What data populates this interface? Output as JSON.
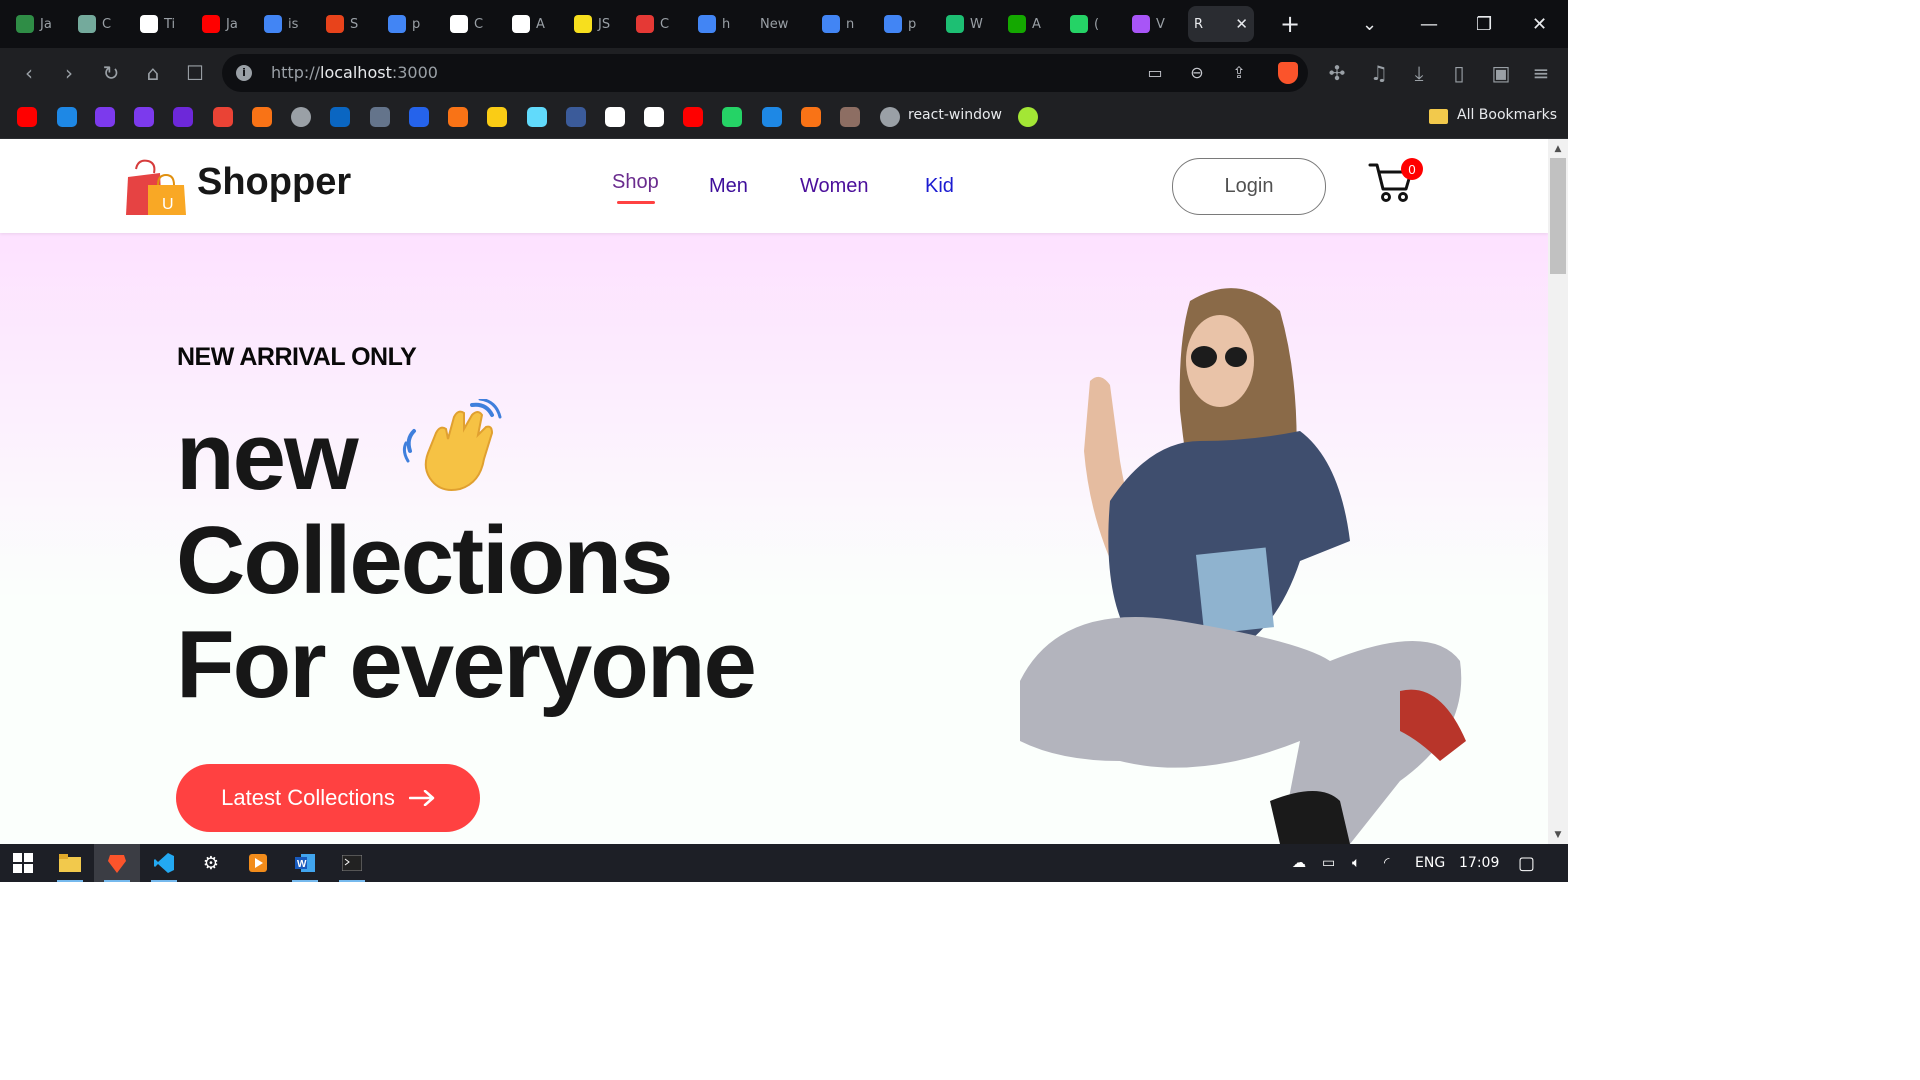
{
  "browser": {
    "tabs": [
      {
        "icon": "geeksforgeeks-icon",
        "label": "Ja",
        "color": "#2f8d46"
      },
      {
        "icon": "chatgpt-icon",
        "label": "C",
        "color": "#74aa9c"
      },
      {
        "icon": "k-icon",
        "label": "Ti",
        "color": "#ffffff"
      },
      {
        "icon": "youtube-icon",
        "label": "Ja",
        "color": "#ff0000"
      },
      {
        "icon": "google-icon",
        "label": "is",
        "color": "#4285f4"
      },
      {
        "icon": "91-icon",
        "label": "S",
        "color": "#e8431b"
      },
      {
        "icon": "google-icon",
        "label": "p",
        "color": "#4285f4"
      },
      {
        "icon": "amazon-icon",
        "label": "C",
        "color": "#ffffff"
      },
      {
        "icon": "amazon-icon",
        "label": "A",
        "color": "#ffffff"
      },
      {
        "icon": "js-icon",
        "label": "JS",
        "color": "#f7df1e"
      },
      {
        "icon": "code-icon",
        "label": "C",
        "color": "#e53935"
      },
      {
        "icon": "google-icon",
        "label": "h",
        "color": "#4285f4"
      },
      {
        "icon": "",
        "label": "New",
        "color": ""
      },
      {
        "icon": "google-icon",
        "label": "n",
        "color": "#4285f4"
      },
      {
        "icon": "google-icon",
        "label": "p",
        "color": "#4285f4"
      },
      {
        "icon": "fiverr-icon",
        "label": "W",
        "color": "#1dbf73"
      },
      {
        "icon": "upwork-icon",
        "label": "A",
        "color": "#14a800"
      },
      {
        "icon": "whatsapp-icon",
        "label": "(",
        "color": "#25d366"
      },
      {
        "icon": "vite-icon",
        "label": "V",
        "color": "#a855f7"
      }
    ],
    "active_tab": {
      "label": "R",
      "close": "✕"
    },
    "new_tab": "+",
    "address": {
      "protocol": "http://",
      "host": "localhost",
      "port": ":3000"
    },
    "bookmarks_label": "react-window",
    "all_bookmarks": "All Bookmarks",
    "bookmark_icons": [
      "youtube-icon",
      "onedrive-icon",
      "u-icon",
      "u-icon",
      "bolt-icon",
      "gmail-icon",
      "basketball-icon",
      "globe-icon",
      "linkedin-icon",
      "calendar-icon",
      "box-icon",
      "arrow-icon",
      "bulb-icon",
      "react-icon",
      "bo-icon",
      "codepen-icon",
      "github-icon",
      "youtube-music-icon",
      "whatsapp-icon",
      "play-icon",
      "f-icon",
      "avatar-icon",
      "globe-icon",
      "tennis-icon"
    ]
  },
  "site": {
    "brand": "Shopper",
    "logo_letter": "U",
    "menu": [
      {
        "label": "Shop",
        "color": "#6a2c8e"
      },
      {
        "label": "Men",
        "color": "#3e0f9b"
      },
      {
        "label": "Women",
        "color": "#4b0f9b"
      },
      {
        "label": "Kid",
        "color": "#1b1bd1"
      }
    ],
    "login_label": "Login",
    "cart_count": "0"
  },
  "hero": {
    "eyebrow": "NEW ARRIVAL ONLY",
    "line1": "new",
    "line2": "Collections",
    "line3": "For everyone",
    "cta_label": "Latest Collections",
    "accent": "#ff4141"
  },
  "taskbar": {
    "language": "ENG",
    "time": "17:09",
    "apps": [
      "windows-start-icon",
      "file-explorer-icon",
      "brave-icon",
      "vscode-icon",
      "settings-icon",
      "media-player-icon",
      "word-icon",
      "terminal-icon"
    ]
  }
}
